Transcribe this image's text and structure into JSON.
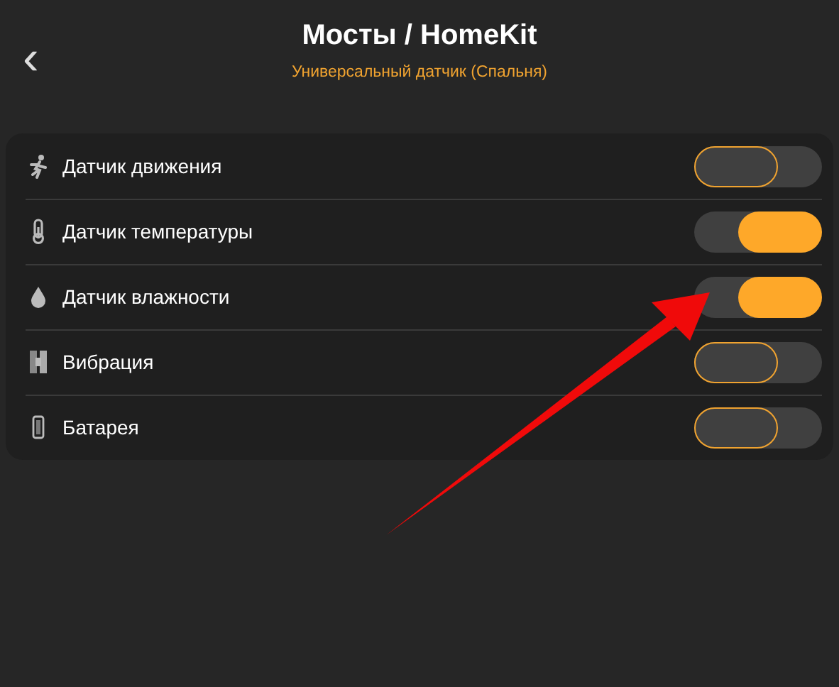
{
  "header": {
    "back": "‹",
    "title": "Мосты / HomeKit",
    "subtitle": "Универсальный датчик (Спальня)"
  },
  "items": [
    {
      "label": "Датчик движения",
      "on": false
    },
    {
      "label": "Датчик температуры",
      "on": true
    },
    {
      "label": "Датчик влажности",
      "on": true
    },
    {
      "label": "Вибрация",
      "on": false
    },
    {
      "label": "Батарея",
      "on": false
    }
  ],
  "annotation": {
    "kind": "arrow"
  }
}
